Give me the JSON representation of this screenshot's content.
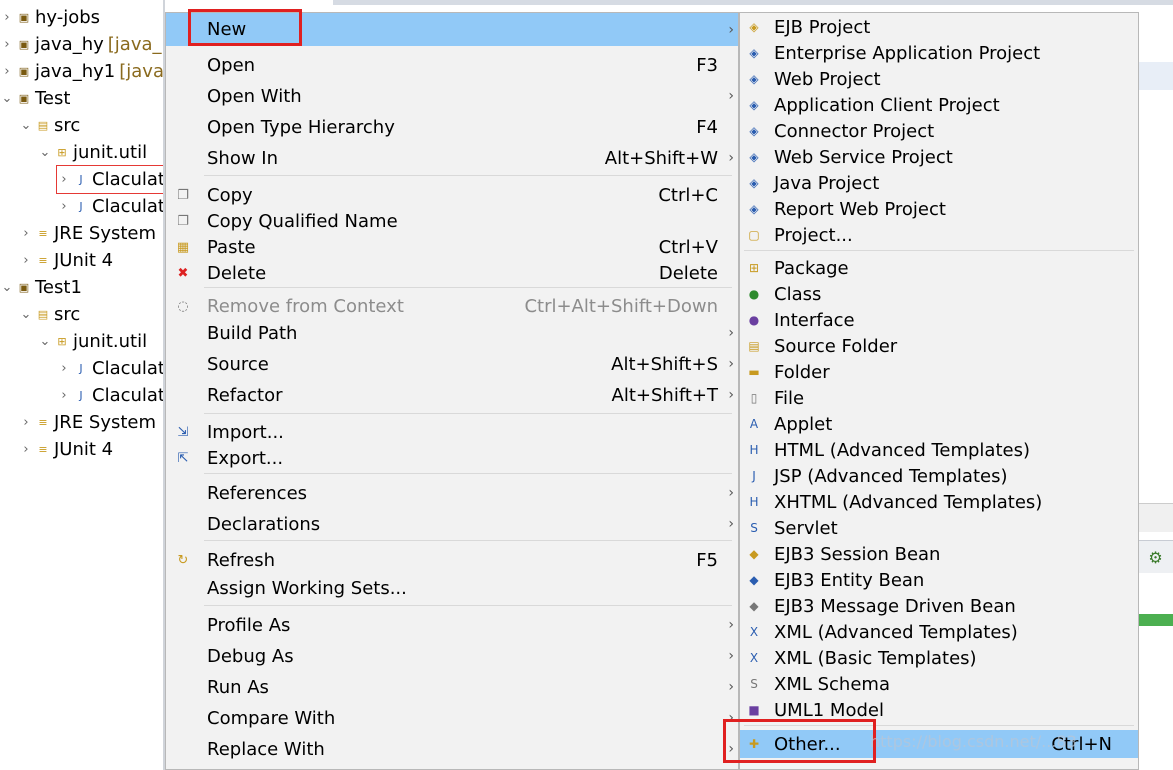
{
  "tree": {
    "rows": [
      {
        "label": "hy-jobs",
        "deco": "",
        "icon": "project-icon"
      },
      {
        "label": "java_hy",
        "deco": "[java_hy",
        "icon": "project-icon"
      },
      {
        "label": "java_hy1",
        "deco": "[java_",
        "icon": "project-icon"
      },
      {
        "label": "Test",
        "deco": "",
        "icon": "project-icon"
      },
      {
        "label": "src",
        "deco": "",
        "icon": "source-folder-icon"
      },
      {
        "label": "junit.util",
        "deco": "",
        "icon": "package-icon"
      },
      {
        "label": "Claculate",
        "deco": "",
        "icon": "java-file-icon"
      },
      {
        "label": "Claculate",
        "deco": "",
        "icon": "java-file-icon"
      },
      {
        "label": "JRE System L",
        "deco": "",
        "icon": "library-icon"
      },
      {
        "label": "JUnit 4",
        "deco": "",
        "icon": "library-icon"
      },
      {
        "label": "Test1",
        "deco": "",
        "icon": "project-icon"
      },
      {
        "label": "src",
        "deco": "",
        "icon": "source-folder-icon"
      },
      {
        "label": "junit.util",
        "deco": "",
        "icon": "package-icon"
      },
      {
        "label": "Claculate",
        "deco": "",
        "icon": "java-file-icon"
      },
      {
        "label": "Claculate",
        "deco": "",
        "icon": "java-file-icon"
      },
      {
        "label": "JRE System L",
        "deco": "",
        "icon": "library-icon"
      },
      {
        "label": "JUnit 4",
        "deco": "",
        "icon": "library-icon"
      }
    ]
  },
  "context_menu": {
    "items": [
      {
        "label": "New",
        "accel": "",
        "submenu": true,
        "icon": ""
      },
      {
        "label": "Open",
        "accel": "F3",
        "submenu": false,
        "icon": ""
      },
      {
        "label": "Open With",
        "accel": "",
        "submenu": true,
        "icon": ""
      },
      {
        "label": "Open Type Hierarchy",
        "accel": "F4",
        "submenu": false,
        "icon": ""
      },
      {
        "label": "Show In",
        "accel": "Alt+Shift+W",
        "submenu": true,
        "icon": ""
      },
      {
        "label": "Copy",
        "accel": "Ctrl+C",
        "submenu": false,
        "icon": "copy-icon"
      },
      {
        "label": "Copy Qualified Name",
        "accel": "",
        "submenu": false,
        "icon": "copy-qualified-icon"
      },
      {
        "label": "Paste",
        "accel": "Ctrl+V",
        "submenu": false,
        "icon": "paste-icon"
      },
      {
        "label": "Delete",
        "accel": "Delete",
        "submenu": false,
        "icon": "delete-icon"
      },
      {
        "label": "Remove from Context",
        "accel": "Ctrl+Alt+Shift+Down",
        "submenu": false,
        "icon": "remove-context-icon",
        "disabled": true
      },
      {
        "label": "Build Path",
        "accel": "",
        "submenu": true,
        "icon": ""
      },
      {
        "label": "Source",
        "accel": "Alt+Shift+S",
        "submenu": true,
        "icon": ""
      },
      {
        "label": "Refactor",
        "accel": "Alt+Shift+T",
        "submenu": true,
        "icon": ""
      },
      {
        "label": "Import...",
        "accel": "",
        "submenu": false,
        "icon": "import-icon"
      },
      {
        "label": "Export...",
        "accel": "",
        "submenu": false,
        "icon": "export-icon"
      },
      {
        "label": "References",
        "accel": "",
        "submenu": true,
        "icon": ""
      },
      {
        "label": "Declarations",
        "accel": "",
        "submenu": true,
        "icon": ""
      },
      {
        "label": "Refresh",
        "accel": "F5",
        "submenu": false,
        "icon": "refresh-icon"
      },
      {
        "label": "Assign Working Sets...",
        "accel": "",
        "submenu": false,
        "icon": ""
      },
      {
        "label": "Profile As",
        "accel": "",
        "submenu": true,
        "icon": ""
      },
      {
        "label": "Debug As",
        "accel": "",
        "submenu": true,
        "icon": ""
      },
      {
        "label": "Run As",
        "accel": "",
        "submenu": true,
        "icon": ""
      },
      {
        "label": "Compare With",
        "accel": "",
        "submenu": true,
        "icon": ""
      },
      {
        "label": "Replace With",
        "accel": "",
        "submenu": true,
        "icon": ""
      }
    ]
  },
  "new_submenu": {
    "items": [
      {
        "label": "EJB Project",
        "icon": "ejb-project-icon"
      },
      {
        "label": "Enterprise Application Project",
        "icon": "enterprise-app-icon"
      },
      {
        "label": "Web Project",
        "icon": "web-project-icon"
      },
      {
        "label": "Application Client Project",
        "icon": "app-client-icon"
      },
      {
        "label": "Connector Project",
        "icon": "connector-project-icon"
      },
      {
        "label": "Web Service Project",
        "icon": "web-service-icon"
      },
      {
        "label": "Java Project",
        "icon": "java-project-icon"
      },
      {
        "label": "Report Web Project",
        "icon": "report-web-icon"
      },
      {
        "label": "Project...",
        "icon": "project-wizard-icon"
      },
      {
        "label": "Package",
        "icon": "package-icon"
      },
      {
        "label": "Class",
        "icon": "class-icon"
      },
      {
        "label": "Interface",
        "icon": "interface-icon"
      },
      {
        "label": "Source Folder",
        "icon": "source-folder-icon"
      },
      {
        "label": "Folder",
        "icon": "folder-icon"
      },
      {
        "label": "File",
        "icon": "file-icon"
      },
      {
        "label": "Applet",
        "icon": "applet-icon"
      },
      {
        "label": "HTML (Advanced Templates)",
        "icon": "html-icon"
      },
      {
        "label": "JSP (Advanced Templates)",
        "icon": "jsp-icon"
      },
      {
        "label": "XHTML (Advanced Templates)",
        "icon": "xhtml-icon"
      },
      {
        "label": "Servlet",
        "icon": "servlet-icon"
      },
      {
        "label": "EJB3 Session Bean",
        "icon": "session-bean-icon"
      },
      {
        "label": "EJB3 Entity Bean",
        "icon": "entity-bean-icon"
      },
      {
        "label": "EJB3 Message Driven Bean",
        "icon": "mdb-icon"
      },
      {
        "label": "XML (Advanced Templates)",
        "icon": "xml-advanced-icon"
      },
      {
        "label": "XML (Basic Templates)",
        "icon": "xml-basic-icon"
      },
      {
        "label": "XML Schema",
        "icon": "xml-schema-icon"
      },
      {
        "label": "UML1 Model",
        "icon": "uml-model-icon"
      },
      {
        "label": "Other...",
        "accel": "Ctrl+N",
        "icon": "other-wizard-icon"
      }
    ]
  },
  "colors": {
    "menu_bg": "#f2f2f2",
    "highlight": "#91c9f7",
    "annotation_red": "#e02020"
  }
}
